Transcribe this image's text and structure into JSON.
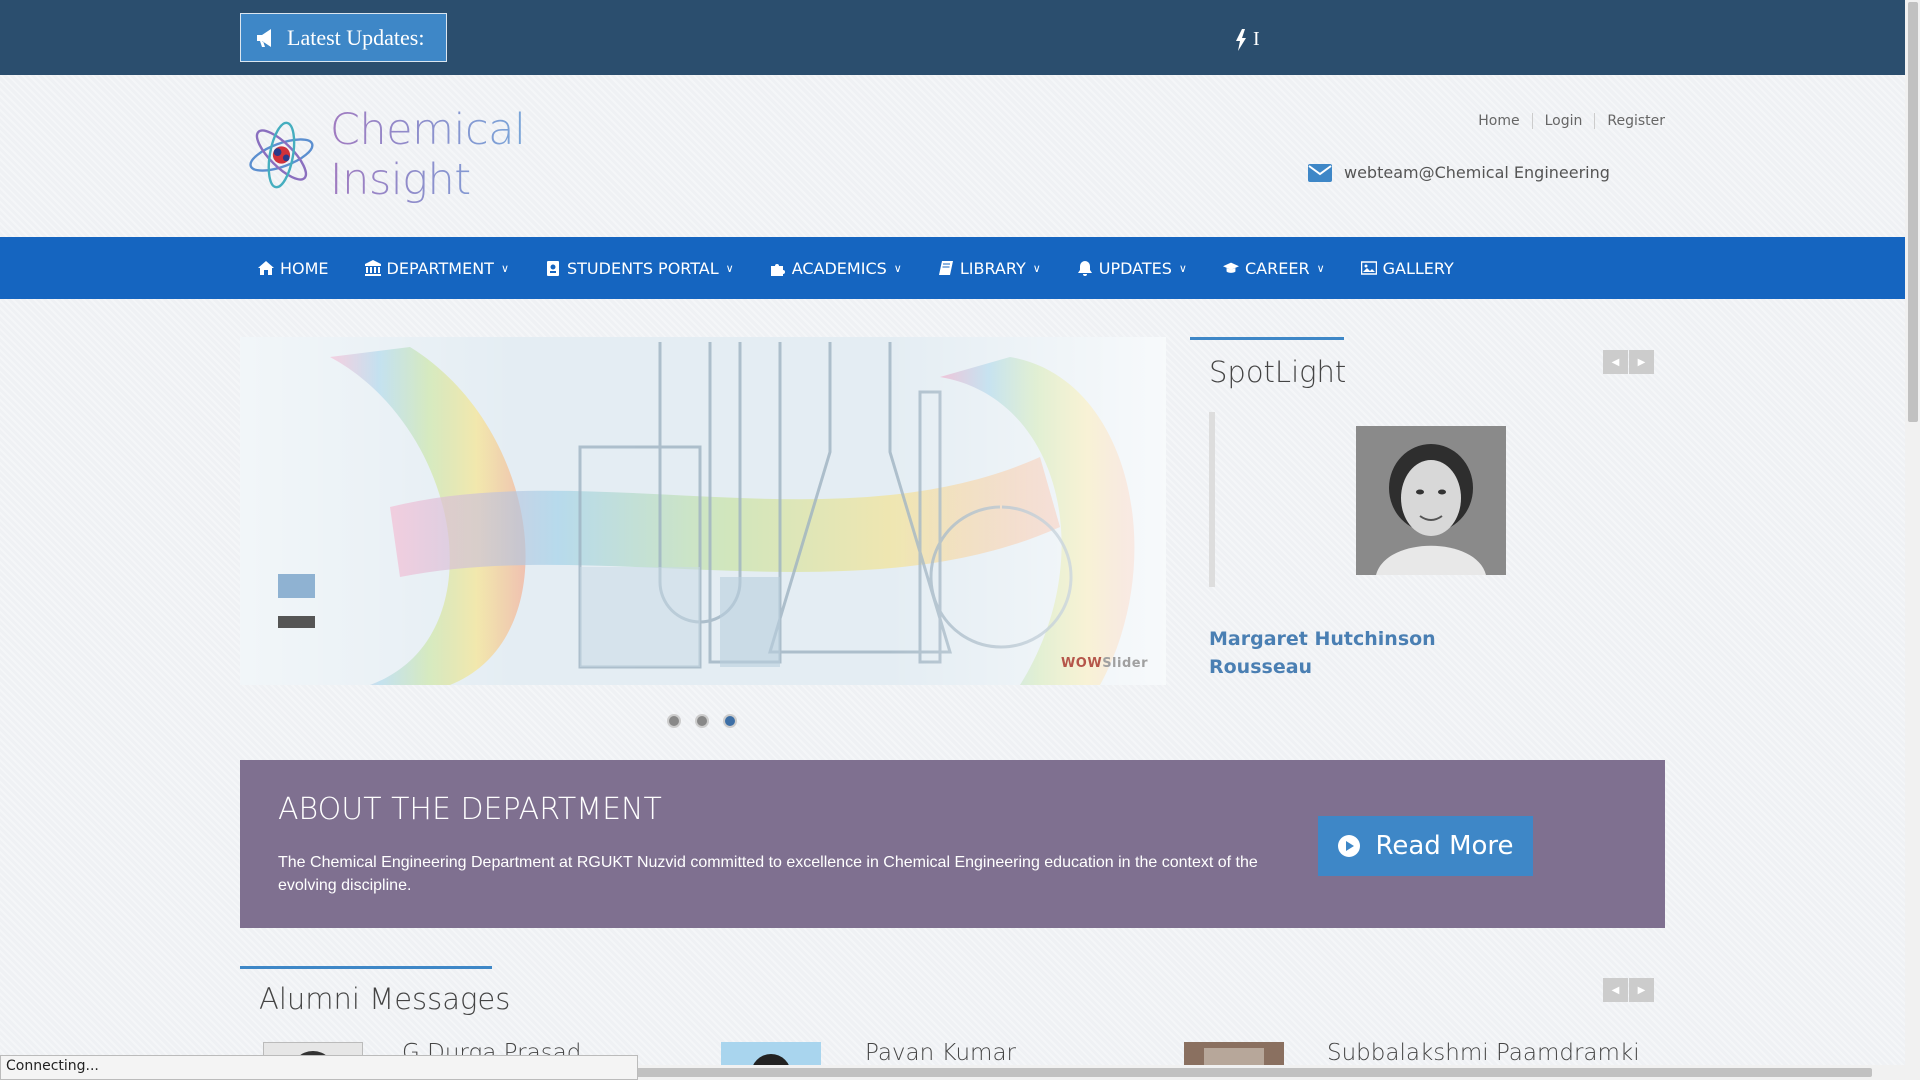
{
  "topbar": {
    "updates_label": "Latest Updates:",
    "ticker_text": "I"
  },
  "header": {
    "logo_text": "Chemical Insight",
    "links": [
      "Home",
      "Login",
      "Register"
    ],
    "email": "webteam@Chemical Engineering"
  },
  "nav": {
    "items": [
      {
        "label": "HOME",
        "icon": "home-icon",
        "dropdown": false
      },
      {
        "label": "DEPARTMENT",
        "icon": "bank-icon",
        "dropdown": true
      },
      {
        "label": "STUDENTS PORTAL",
        "icon": "id-badge-icon",
        "dropdown": true
      },
      {
        "label": "ACADEMICS",
        "icon": "puzzle-icon",
        "dropdown": true
      },
      {
        "label": "LIBRARY",
        "icon": "book-icon",
        "dropdown": true
      },
      {
        "label": "UPDATES",
        "icon": "bell-icon",
        "dropdown": true
      },
      {
        "label": "CAREER",
        "icon": "graduation-cap-icon",
        "dropdown": true
      },
      {
        "label": "GALLERY",
        "icon": "image-icon",
        "dropdown": false
      }
    ]
  },
  "slider": {
    "watermark_a": "WOW",
    "watermark_b": "Slider",
    "dots": 3,
    "active_dot": 3
  },
  "spotlight": {
    "title": "SpotLight",
    "name": "Margaret Hutchinson Rousseau"
  },
  "about": {
    "title": "ABOUT THE DEPARTMENT",
    "text": "The Chemical Engineering Department at RGUKT Nuzvid committed to excellence in Chemical Engineering education in the context of the evolving discipline.",
    "button_label": "Read More"
  },
  "alumni": {
    "title": "Alumni Messages",
    "people": [
      "G Durga Prasad",
      "Pavan Kumar",
      "Subbalakshmi Paamdramki"
    ]
  },
  "status_text": "Connecting...",
  "colors": {
    "topbar": "#2b4e6e",
    "nav": "#1565c0",
    "accent": "#3e87c7",
    "about_bg": "#7f7090"
  }
}
